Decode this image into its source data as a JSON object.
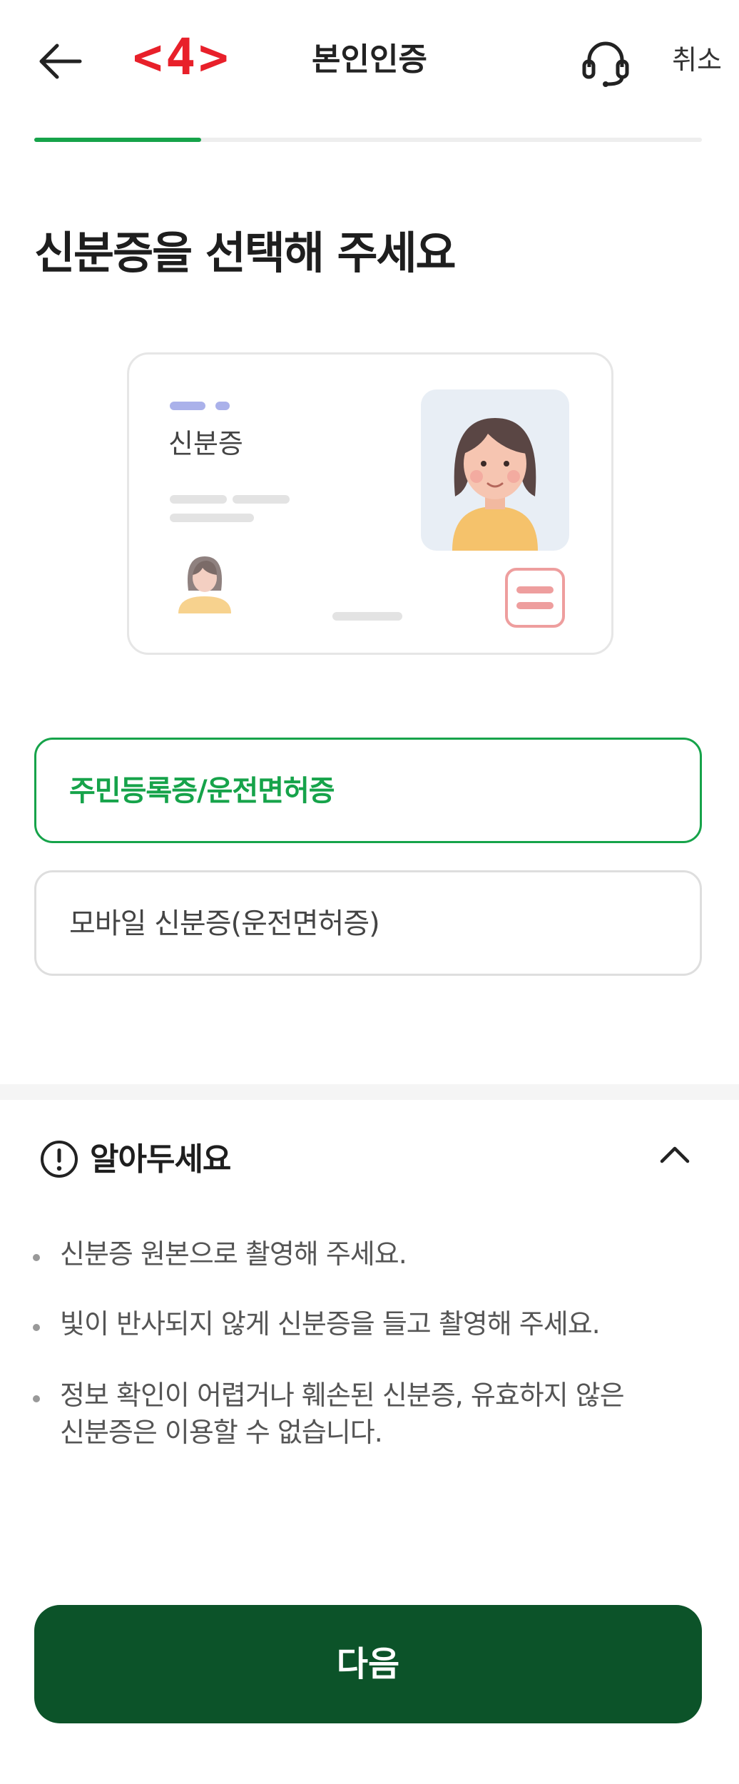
{
  "header": {
    "step_marker": "<4>",
    "title": "본인인증",
    "cancel_label": "취소",
    "progress": 0.25
  },
  "heading": "신분증을 선택해 주세요",
  "illustration": {
    "card_label": "신분증"
  },
  "options": [
    {
      "label": "주민등록증/운전면허증",
      "selected": true
    },
    {
      "label": "모바일 신분증(운전면허증)",
      "selected": false
    }
  ],
  "notice": {
    "title": "알아두세요",
    "items": [
      "신분증 원본으로 촬영해 주세요.",
      "빛이 반사되지 않게 신분증을 들고 촬영해 주세요.",
      "정보 확인이 어렵거나 훼손된 신분증, 유효하지 않은 신분증은 이용할 수 없습니다."
    ]
  },
  "next_button": "다음",
  "colors": {
    "accent": "#16a34a",
    "primary_button": "#0c5329",
    "step_marker": "#e8202a"
  },
  "icons": [
    "back-arrow-icon",
    "headset-icon",
    "info-circle-icon",
    "chevron-up-icon"
  ]
}
